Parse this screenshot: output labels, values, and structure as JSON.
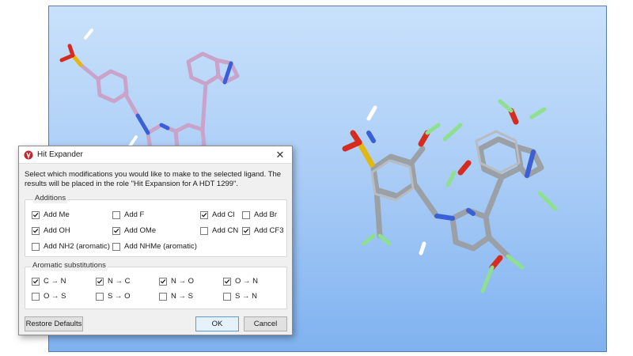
{
  "dialog": {
    "title": "Hit Expander",
    "close_glyph": "✕",
    "description": "Select which modifications you would like to make to the selected ligand. The results will be placed in the role \"Hit Expansion for A HDT 1299\".",
    "additions": {
      "title": "Additions",
      "items": [
        {
          "label": "Add Me",
          "checked": true
        },
        {
          "label": "Add F",
          "checked": false
        },
        {
          "label": "Add Cl",
          "checked": true
        },
        {
          "label": "Add Br",
          "checked": false
        },
        {
          "label": "Add OH",
          "checked": true
        },
        {
          "label": "Add OMe",
          "checked": true
        },
        {
          "label": "Add CN",
          "checked": false
        },
        {
          "label": "Add CF3",
          "checked": true
        },
        {
          "label": "Add NH2 (aromatic)",
          "checked": false
        },
        {
          "label": "Add NHMe (aromatic)",
          "checked": false
        }
      ]
    },
    "aromatic": {
      "title": "Aromatic substitutions",
      "items": [
        {
          "label": "C → N",
          "checked": true
        },
        {
          "label": "N → C",
          "checked": true
        },
        {
          "label": "N → O",
          "checked": true
        },
        {
          "label": "O → N",
          "checked": true
        },
        {
          "label": "O → S",
          "checked": false
        },
        {
          "label": "S → O",
          "checked": false
        },
        {
          "label": "N → S",
          "checked": false
        },
        {
          "label": "S → N",
          "checked": false
        }
      ]
    },
    "buttons": {
      "restore": "Restore Defaults",
      "ok": "OK",
      "cancel": "Cancel"
    }
  },
  "colors": {
    "ligand": "#c9a3c9",
    "carbon": "#9aa0a6",
    "nitrogen": "#3b5fd6",
    "oxygen": "#d62b1f",
    "sulfur": "#e2b712",
    "fluorine": "#8ee08e",
    "accent": "#0078d7"
  },
  "icons": {
    "app": "hit-expander-icon",
    "close": "close-icon",
    "check": "checkmark-icon"
  }
}
